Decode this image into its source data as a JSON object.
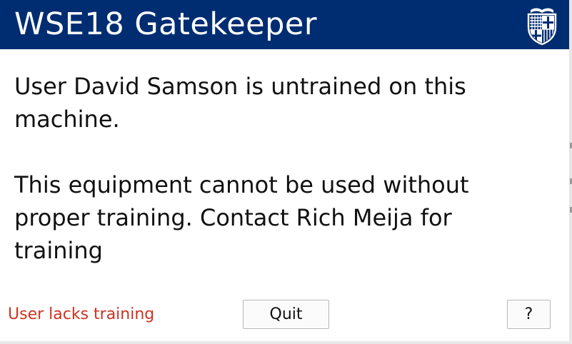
{
  "window": {
    "title": "WSE18 Gatekeeper",
    "logo_icon": "university-shield-icon"
  },
  "message": {
    "line1": "User David Samson is untrained on this machine.",
    "line2": "This equipment cannot be used without proper training. Contact Rich Meija for training"
  },
  "status": {
    "text": "User lacks training",
    "color": "#cc3322"
  },
  "buttons": {
    "quit_label": "Quit",
    "help_label": "?"
  },
  "colors": {
    "header": "#002d72",
    "text": "#111111"
  }
}
